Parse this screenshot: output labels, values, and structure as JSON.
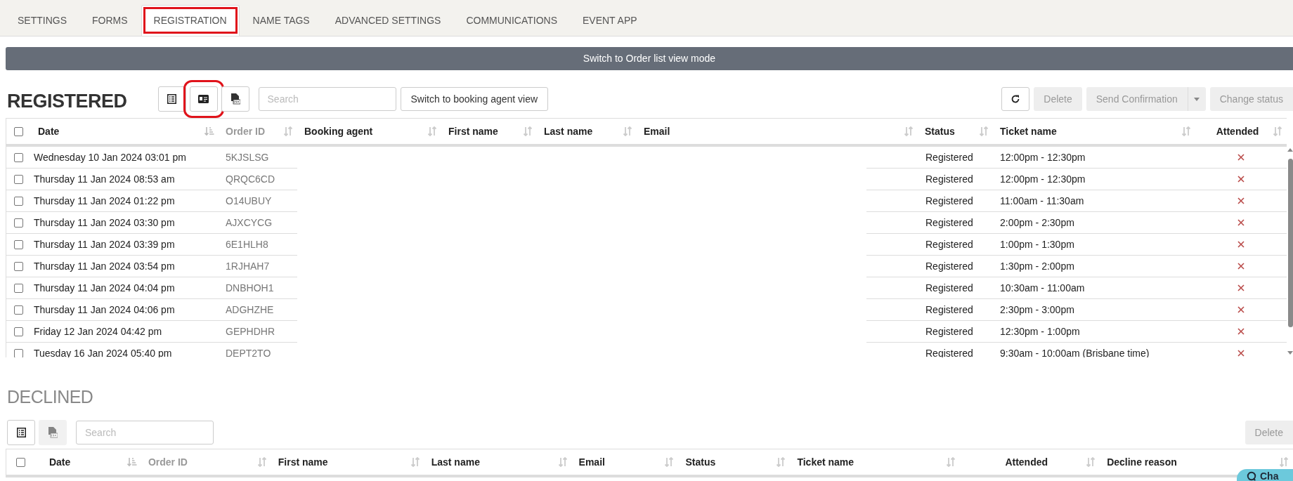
{
  "tabs": [
    {
      "label": "SETTINGS",
      "selected": false,
      "annotated": false
    },
    {
      "label": "FORMS",
      "selected": false,
      "annotated": false
    },
    {
      "label": "REGISTRATION",
      "selected": true,
      "annotated": true
    },
    {
      "label": "NAME TAGS",
      "selected": false,
      "annotated": false
    },
    {
      "label": "ADVANCED SETTINGS",
      "selected": false,
      "annotated": false
    },
    {
      "label": "COMMUNICATIONS",
      "selected": false,
      "annotated": false
    },
    {
      "label": "EVENT APP",
      "selected": false,
      "annotated": false
    }
  ],
  "view_mode_bar": {
    "label": "Switch to Order list view mode"
  },
  "registered": {
    "title": "REGISTERED",
    "view_buttons": [
      {
        "kind": "list",
        "annotated": false,
        "disabled": false
      },
      {
        "kind": "card",
        "annotated": true,
        "disabled": false
      },
      {
        "kind": "csv",
        "annotated": false,
        "disabled": false
      }
    ],
    "search": {
      "placeholder": "Search"
    },
    "agent_view_button": {
      "label": "Switch to booking agent view"
    },
    "delete_button": {
      "label": "Delete",
      "disabled": true
    },
    "send_confirmation_button": {
      "label": "Send Confirmation",
      "disabled": true
    },
    "change_status_button": {
      "label": "Change status",
      "disabled": true
    },
    "table": {
      "select_all": {
        "checked": false
      },
      "columns": [
        {
          "label": "Date",
          "sorted": true,
          "dimmed": false
        },
        {
          "label": "Order ID",
          "sorted": false,
          "dimmed": true
        },
        {
          "label": "Booking agent",
          "sorted": false,
          "dimmed": false
        },
        {
          "label": "First name",
          "sorted": false,
          "dimmed": false
        },
        {
          "label": "Last name",
          "sorted": false,
          "dimmed": false
        },
        {
          "label": "Email",
          "sorted": false,
          "dimmed": false
        },
        {
          "label": "Status",
          "sorted": false,
          "dimmed": false
        },
        {
          "label": "Ticket name",
          "sorted": false,
          "dimmed": false
        },
        {
          "label": "Attended",
          "sorted": false,
          "dimmed": false
        }
      ],
      "rows": [
        {
          "checked": false,
          "date": "Wednesday 10 Jan 2024 03:01 pm",
          "order_id": "5KJSLSG",
          "status": "Registered",
          "ticket": "12:00pm - 12:30pm",
          "attended": false
        },
        {
          "checked": false,
          "date": "Thursday 11 Jan 2024 08:53 am",
          "order_id": "QRQC6CD",
          "status": "Registered",
          "ticket": "12:00pm - 12:30pm",
          "attended": false
        },
        {
          "checked": false,
          "date": "Thursday 11 Jan 2024 01:22 pm",
          "order_id": "O14UBUY",
          "status": "Registered",
          "ticket": "11:00am - 11:30am",
          "attended": false
        },
        {
          "checked": false,
          "date": "Thursday 11 Jan 2024 03:30 pm",
          "order_id": "AJXCYCG",
          "status": "Registered",
          "ticket": "2:00pm - 2:30pm",
          "attended": false
        },
        {
          "checked": false,
          "date": "Thursday 11 Jan 2024 03:39 pm",
          "order_id": "6E1HLH8",
          "status": "Registered",
          "ticket": "1:00pm - 1:30pm",
          "attended": false
        },
        {
          "checked": false,
          "date": "Thursday 11 Jan 2024 03:54 pm",
          "order_id": "1RJHAH7",
          "status": "Registered",
          "ticket": "1:30pm - 2:00pm",
          "attended": false
        },
        {
          "checked": false,
          "date": "Thursday 11 Jan 2024 04:04 pm",
          "order_id": "DNBHOH1",
          "status": "Registered",
          "ticket": "10:30am - 11:00am",
          "attended": false
        },
        {
          "checked": false,
          "date": "Thursday 11 Jan 2024 04:06 pm",
          "order_id": "ADGHZHE",
          "status": "Registered",
          "ticket": "2:30pm - 3:00pm",
          "attended": false
        },
        {
          "checked": false,
          "date": "Friday 12 Jan 2024 04:42 pm",
          "order_id": "GEPHDHR",
          "status": "Registered",
          "ticket": "12:30pm - 1:00pm",
          "attended": false
        },
        {
          "checked": false,
          "date": "Tuesday 16 Jan 2024 05:40 pm",
          "order_id": "DEPT2TO",
          "status": "Registered",
          "ticket": "9:30am - 10:00am (Brisbane time)",
          "attended": false
        }
      ]
    }
  },
  "declined": {
    "title": "DECLINED",
    "view_buttons": [
      {
        "kind": "list",
        "annotated": false,
        "disabled": false
      },
      {
        "kind": "csv",
        "annotated": false,
        "disabled": true
      }
    ],
    "search": {
      "placeholder": "Search"
    },
    "delete_button": {
      "label": "Delete",
      "disabled": true
    },
    "table": {
      "select_all": {
        "checked": false
      },
      "columns": [
        {
          "label": "Date",
          "sorted": true,
          "dimmed": false
        },
        {
          "label": "Order ID",
          "sorted": false,
          "dimmed": true
        },
        {
          "label": "First name",
          "sorted": false,
          "dimmed": false
        },
        {
          "label": "Last name",
          "sorted": false,
          "dimmed": false
        },
        {
          "label": "Email",
          "sorted": false,
          "dimmed": false
        },
        {
          "label": "Status",
          "sorted": false,
          "dimmed": false
        },
        {
          "label": "Ticket name",
          "sorted": false,
          "dimmed": false
        },
        {
          "label": "Attended",
          "sorted": false,
          "dimmed": false
        },
        {
          "label": "Decline reason",
          "sorted": false,
          "dimmed": false
        }
      ]
    }
  },
  "chat_button": {
    "label": "Cha"
  }
}
